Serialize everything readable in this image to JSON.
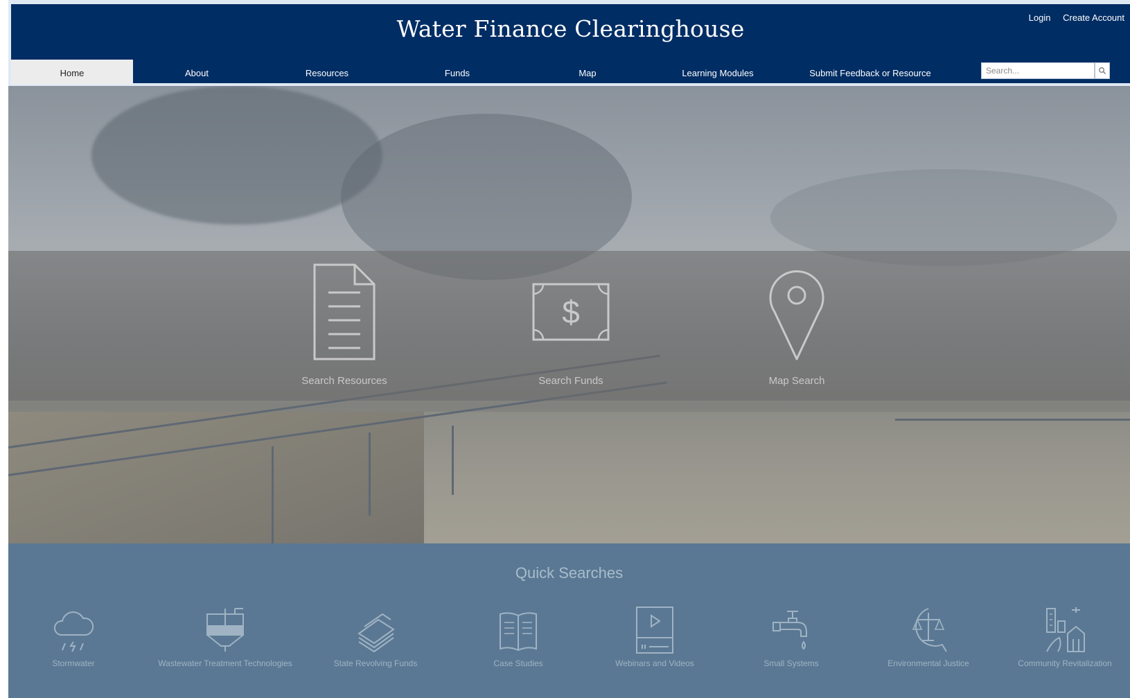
{
  "header": {
    "site_title": "Water Finance Clearinghouse",
    "login": "Login",
    "create_account": "Create Account",
    "bg_color": "#002d64"
  },
  "nav": {
    "items": [
      "Home",
      "About",
      "Resources",
      "Funds",
      "Map",
      "Learning Modules",
      "Submit Feedback or Resource"
    ],
    "active": "Home"
  },
  "search": {
    "placeholder": "Search...",
    "icon": "search-icon"
  },
  "hero": {
    "features": [
      {
        "label": "Search Resources",
        "icon": "document-icon"
      },
      {
        "label": "Search Funds",
        "icon": "dollar-bill-icon"
      },
      {
        "label": "Map Search",
        "icon": "map-pin-icon"
      }
    ]
  },
  "quick_searches": {
    "title": "Quick Searches",
    "bg_color": "#5a7893",
    "items": [
      {
        "label": "Stormwater",
        "icon": "rain-cloud-icon"
      },
      {
        "label": "Wastewater Treatment Technologies",
        "icon": "treatment-tank-icon"
      },
      {
        "label": "State Revolving Funds",
        "icon": "money-stack-icon"
      },
      {
        "label": "Case Studies",
        "icon": "open-book-icon"
      },
      {
        "label": "Webinars and Videos",
        "icon": "video-icon"
      },
      {
        "label": "Small Systems",
        "icon": "faucet-icon"
      },
      {
        "label": "Environmental Justice",
        "icon": "scales-icon"
      },
      {
        "label": "Community Revitalization",
        "icon": "city-icon"
      }
    ]
  }
}
